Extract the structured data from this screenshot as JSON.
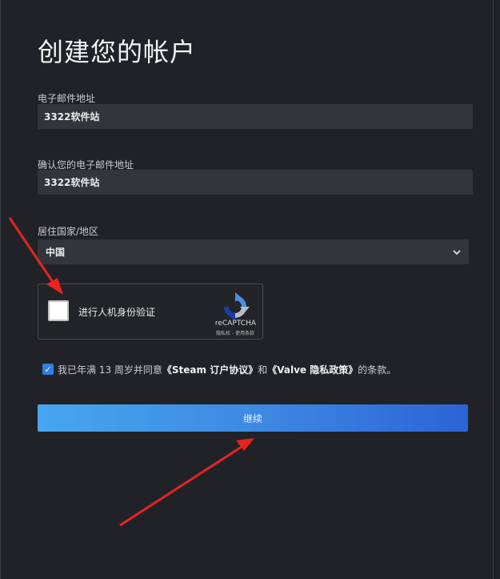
{
  "page": {
    "title": "创建您的帐户"
  },
  "form": {
    "email_label": "电子邮件地址",
    "email_value": "3322软件站",
    "confirm_email_label": "确认您的电子邮件地址",
    "confirm_email_value": "3322软件站",
    "country_label": "居住国家/地区",
    "country_value": "中国"
  },
  "captcha": {
    "text": "进行人机身份验证",
    "brand": "reCAPTCHA",
    "links": "隐私权 - 使用条款"
  },
  "agreement": {
    "prefix": "我已年满 13 周岁并同意",
    "steam_agreement": "《Steam 订户协议》",
    "and": "和",
    "valve_privacy": "《Valve 隐私政策》",
    "suffix": "的条款。",
    "check_glyph": "✓"
  },
  "continue_button": {
    "label": "继续"
  },
  "icons": {
    "dropdown": "chevron-down-icon",
    "annotation": "red-arrow-icon"
  },
  "colors": {
    "accent": "#2f7fe8",
    "annotation_arrow": "#e8231f"
  }
}
